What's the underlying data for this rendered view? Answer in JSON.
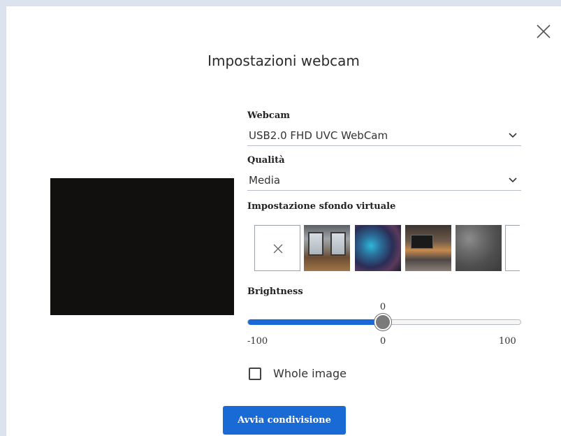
{
  "dialog": {
    "title": "Impostazioni webcam",
    "close_icon": "close-icon"
  },
  "webcam": {
    "label": "Webcam",
    "value": "USB2.0 FHD UVC WebCam",
    "icon": "chevron-down-icon"
  },
  "quality": {
    "label": "Qualità",
    "value": "Media",
    "icon": "chevron-down-icon"
  },
  "background": {
    "label": "Impostazione sfondo virtuale",
    "items": [
      {
        "name": "none",
        "icon": "close-icon"
      },
      {
        "name": "office"
      },
      {
        "name": "blur"
      },
      {
        "name": "lounge"
      },
      {
        "name": "stone"
      },
      {
        "name": "partial"
      }
    ]
  },
  "brightness": {
    "label": "Brightness",
    "current_value": "0",
    "min_label": "-100",
    "mid_label": "0",
    "max_label": "100",
    "level": 0.5
  },
  "whole_image": {
    "label": "Whole image",
    "checked": false
  },
  "actions": {
    "primary_label": "Avvia condivisione",
    "primary_color": "#1a6ad6"
  }
}
